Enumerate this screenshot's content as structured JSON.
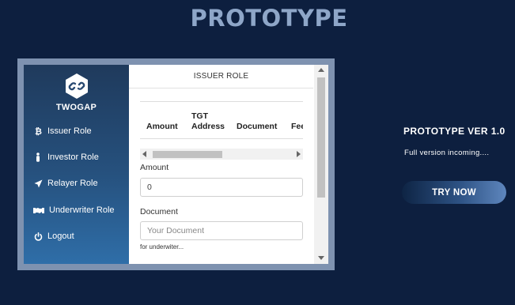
{
  "page": {
    "title": "PROTOTYPE"
  },
  "app": {
    "brand": "TWOGAP",
    "logo_icon": "link-chain-icon",
    "nav": [
      {
        "label": "Issuer Role",
        "icon": "bitcoin-icon"
      },
      {
        "label": "Investor Role",
        "icon": "person-icon"
      },
      {
        "label": "Relayer Role",
        "icon": "paper-plane-icon"
      },
      {
        "label": "Underwriter Role",
        "icon": "handshake-icon"
      },
      {
        "label": "Logout",
        "icon": "power-icon"
      }
    ],
    "content": {
      "header": "ISSUER ROLE",
      "table_columns": [
        "Amount",
        "TGT Address",
        "Document",
        "Fee"
      ],
      "amount_label": "Amount",
      "amount_value": "0",
      "document_label": "Document",
      "document_placeholder": "Your Document",
      "document_hint": "for underwiter..."
    }
  },
  "info": {
    "version": "PROTOTYPE VER 1.0",
    "subtitle": "Full version incoming....",
    "cta_label": "TRY NOW"
  },
  "colors": {
    "background": "#0d1f3f",
    "title": "#8ea6c8",
    "sidebar_top": "#1f3a5c",
    "sidebar_bottom": "#2f6ea8"
  }
}
